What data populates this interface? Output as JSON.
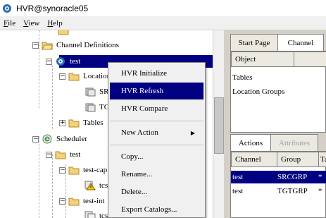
{
  "window": {
    "title": "HVR@synoracle05"
  },
  "menubar": {
    "file": "File",
    "view": "View",
    "help": "Help"
  },
  "tree": {
    "channel_definitions": "Channel Definitions",
    "channel_test": "test",
    "locations": "Locations",
    "loc_src": "SRC",
    "loc_tgt": "TGT",
    "tables": "Tables",
    "scheduler": "Scheduler",
    "sched_test": "test",
    "test_capture": "test-cap",
    "tcs1": "tcs",
    "test_integrate": "test-int",
    "tcs2": "tcs"
  },
  "context_menu": {
    "hvr_initialize": "HVR Initialize",
    "hvr_refresh": "HVR Refresh",
    "hvr_compare": "HVR Compare",
    "new_action": "New Action",
    "copy": "Copy...",
    "rename": "Rename...",
    "delete": "Delete...",
    "export_catalogs": "Export Catalogs..."
  },
  "right_panel": {
    "tabs": [
      "Start Page",
      "Channel"
    ],
    "object_header": "Object",
    "objects": [
      "Tables",
      "Location Groups"
    ],
    "bottom_tabs": [
      "Actions",
      "Attributes"
    ],
    "grid_headers": [
      "Channel",
      "Group",
      "Ta"
    ],
    "rows": [
      {
        "channel": "test",
        "group": "SRCGRP",
        "table": "*"
      },
      {
        "channel": "test",
        "group": "TGTGRP",
        "table": "*"
      }
    ]
  },
  "colors": {
    "selection": "#000080",
    "chrome": "#d4d0c8",
    "menu_bg": "#f0f0f0"
  }
}
